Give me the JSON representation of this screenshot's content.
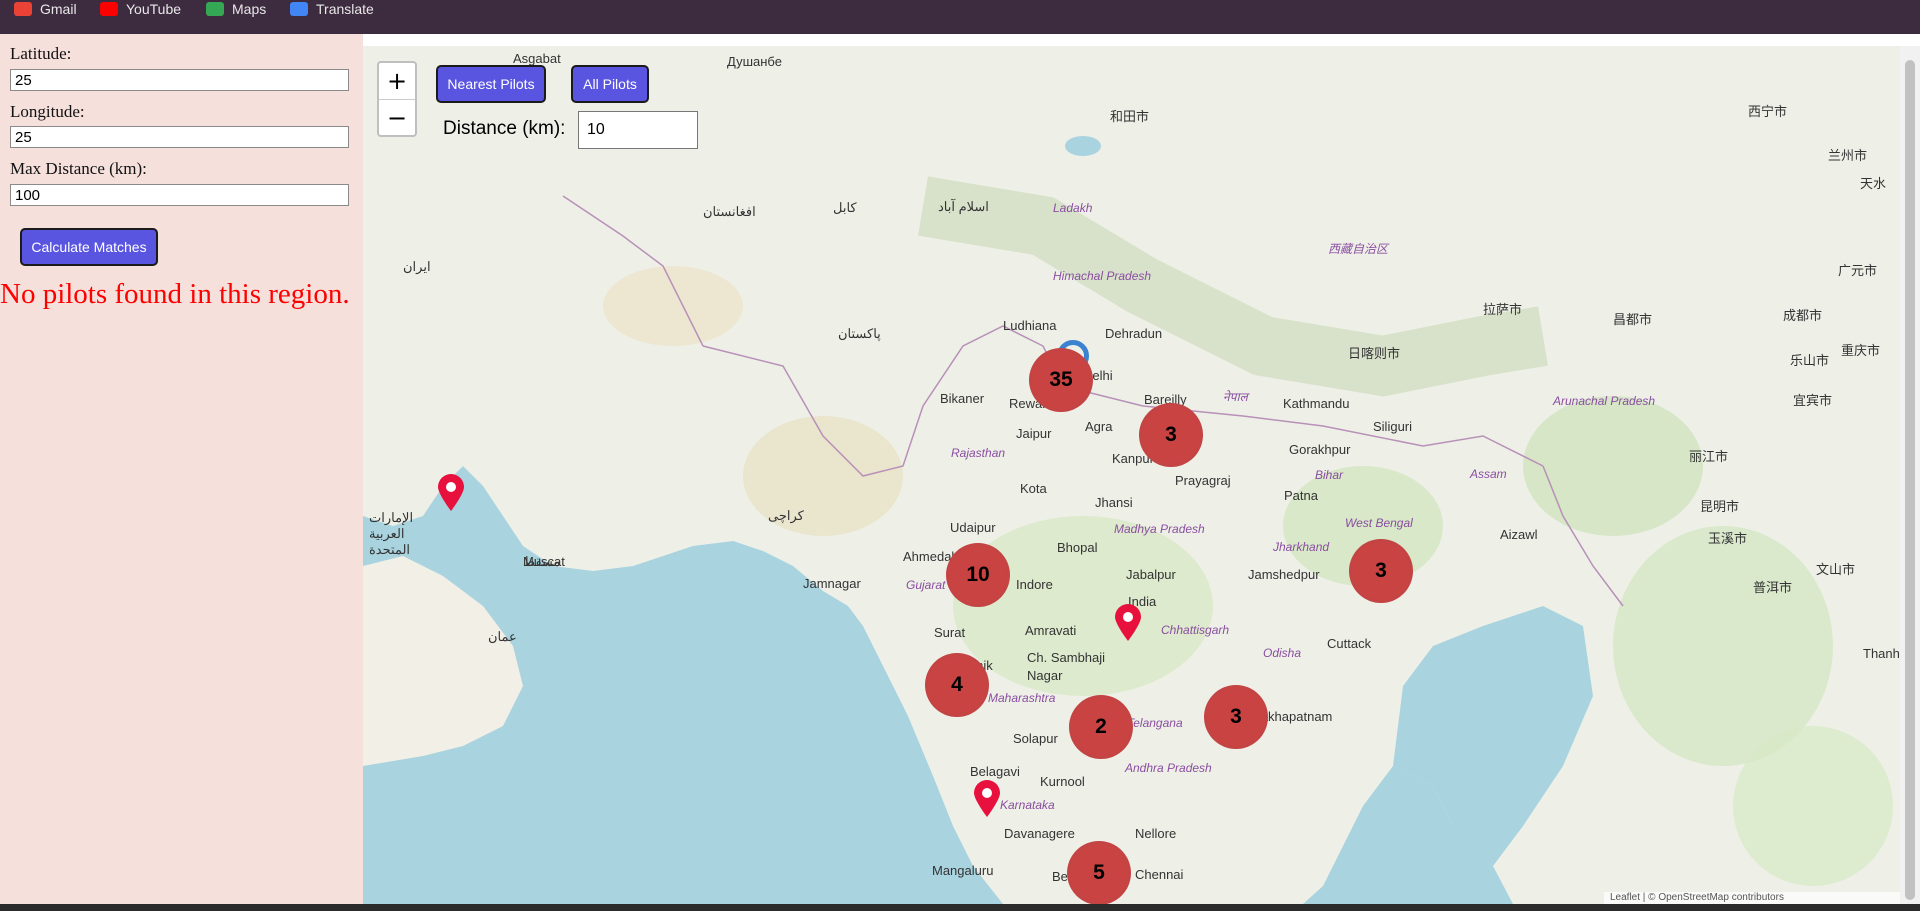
{
  "bookmarks": [
    {
      "label": "Gmail",
      "icon": "gmail-icon",
      "color": "#ea4335"
    },
    {
      "label": "YouTube",
      "icon": "youtube-icon",
      "color": "#ff0000"
    },
    {
      "label": "Maps",
      "icon": "maps-icon",
      "color": "#34a853"
    },
    {
      "label": "Translate",
      "icon": "translate-icon",
      "color": "#4285f4"
    }
  ],
  "form": {
    "latitude_label": "Latitude:",
    "latitude_value": "25",
    "longitude_label": "Longitude:",
    "longitude_value": "25",
    "maxdist_label": "Max Distance (km):",
    "maxdist_value": "100",
    "calc_button": "Calculate Matches",
    "no_results": "No pilots found in this region."
  },
  "map": {
    "zoom_in": "+",
    "zoom_out": "−",
    "nearest_button": "Nearest Pilots",
    "all_button": "All Pilots",
    "distance_label": "Distance (km):",
    "distance_value": "10",
    "clusters": [
      "35",
      "3",
      "10",
      "3",
      "4",
      "2",
      "3",
      "5"
    ],
    "labels": [
      "Душанбе",
      "Asgabat",
      "Ladakh",
      "Himachal Pradesh",
      "Ludhiana",
      "Dehradun",
      "Rewari",
      "Delhi",
      "Bareilly",
      "नेपाल",
      "Jaipur",
      "Agra",
      "Kanpur",
      "Prayagraj",
      "Gorakhpur",
      "Bikaner",
      "Rajasthan",
      "Kota",
      "Jhansi",
      "Patna",
      "Bihar",
      "Siliguri",
      "Udaipur",
      "Bhopal",
      "Madhya Pradesh",
      "Jharkhand",
      "West Bengal",
      "Ahmedabad",
      "Indore",
      "Jabalpur",
      "Jamshedpur",
      "Jamnagar",
      "Gujarat",
      "India",
      "Surat",
      "Amravati",
      "Chhattisgarh",
      "Cuttack",
      "Odisha",
      "Ch. Sambhaji Nagar",
      "Maharashtra",
      "Nashik",
      "Solapur",
      "Telangana",
      "Visakhapatnam",
      "Belagavi",
      "Kurnool",
      "Andhra Pradesh",
      "Karnataka",
      "Davanagere",
      "Nellore",
      "Mangaluru",
      "Bengaluru",
      "Chennai",
      "Aizawl",
      "Assam",
      "Arunachal Pradesh",
      "Kathmandu",
      "西藏自治区",
      "拉萨市",
      "日喀则市",
      "昌都市",
      "成都市",
      "重庆市",
      "西宁市",
      "兰州市",
      "天水",
      "广元市",
      "乐山市",
      "宜宾市",
      "丽江市",
      "昆明市",
      "玉溪市",
      "文山市",
      "普洱市",
      "和田市",
      "Thanh",
      "Muscat",
      "عمان",
      "الإمارات العربية المتحدة",
      "ايران",
      "افغانستان",
      "پاکستان",
      "کراچی",
      "کابل",
      "اسلام آباد",
      "مسقط"
    ],
    "attribution": "Leaflet | © OpenStreetMap contributors"
  }
}
